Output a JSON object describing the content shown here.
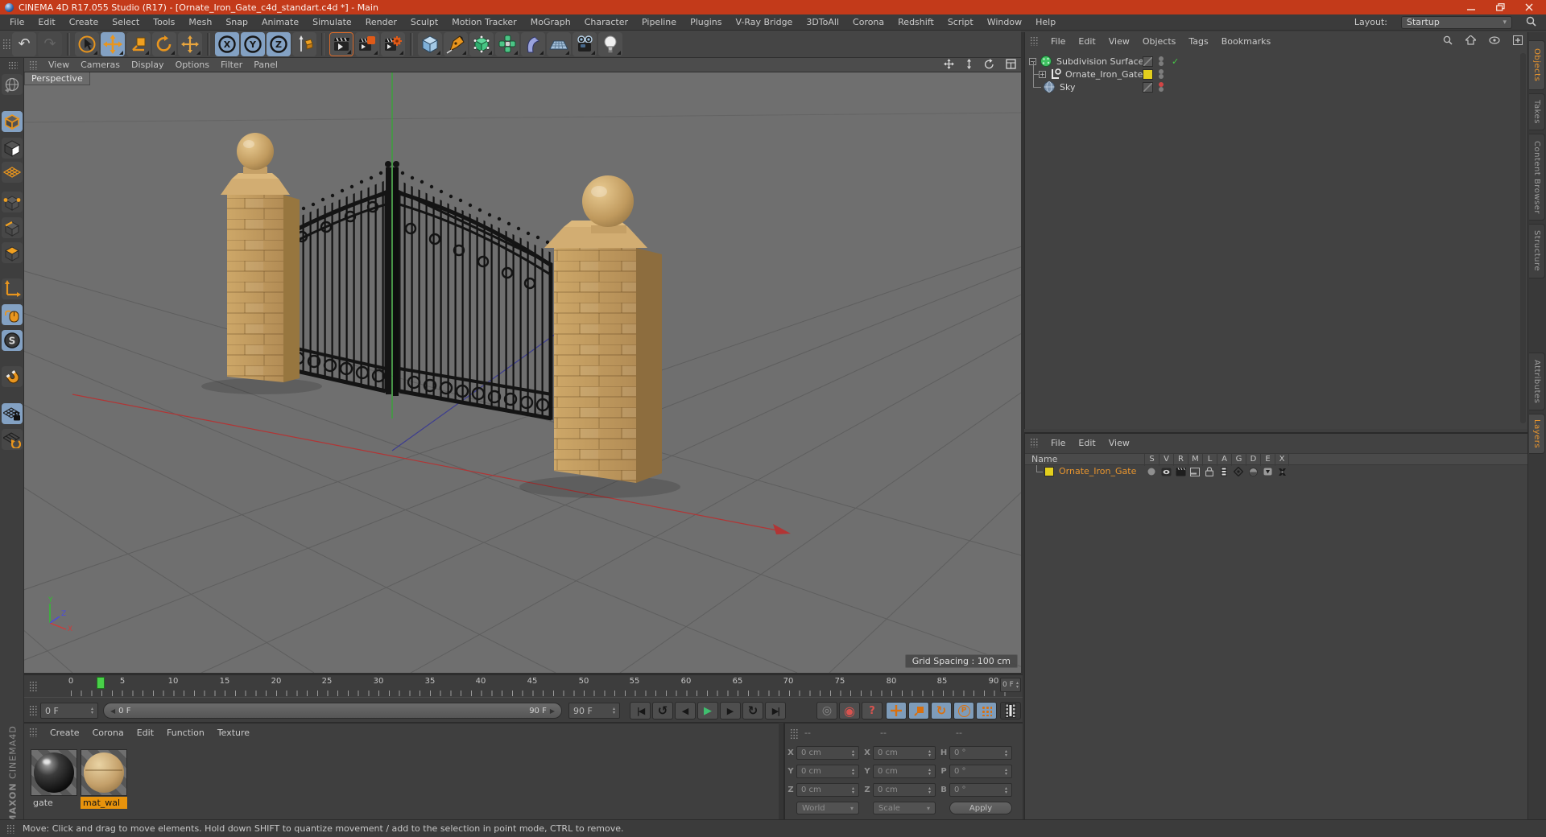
{
  "window": {
    "title": "CINEMA 4D R17.055 Studio (R17) - [Ornate_Iron_Gate_c4d_standart.c4d *] - Main"
  },
  "menubar": {
    "items": [
      "File",
      "Edit",
      "Create",
      "Select",
      "Tools",
      "Mesh",
      "Snap",
      "Animate",
      "Simulate",
      "Render",
      "Sculpt",
      "Motion Tracker",
      "MoGraph",
      "Character",
      "Pipeline",
      "Plugins",
      "V-Ray Bridge",
      "3DToAll",
      "Corona",
      "Redshift",
      "Script",
      "Window",
      "Help"
    ],
    "layout_label": "Layout:",
    "layout_value": "Startup"
  },
  "toolbar": {
    "axis_labels": [
      "X",
      "Y",
      "Z"
    ]
  },
  "left_toolbar": {
    "snap_label": "S"
  },
  "viewport": {
    "menu": [
      "View",
      "Cameras",
      "Display",
      "Options",
      "Filter",
      "Panel"
    ],
    "view_label": "Perspective",
    "grid_spacing_label": "Grid Spacing : 100 cm",
    "axis_x": "X",
    "axis_y": "Y",
    "axis_z": "Z"
  },
  "object_manager": {
    "menu": [
      "File",
      "Edit",
      "View",
      "Objects",
      "Tags",
      "Bookmarks"
    ],
    "objects": [
      {
        "name": "Subdivision Surface"
      },
      {
        "name": "Ornate_Iron_Gate"
      },
      {
        "name": "Sky"
      }
    ],
    "enabled_check": "✓"
  },
  "right_tabs": {
    "top": [
      "Objects",
      "Takes",
      "Content Browser",
      "Structure"
    ],
    "bottom": [
      "Attributes",
      "Layers"
    ]
  },
  "layer_manager": {
    "menu": [
      "File",
      "Edit",
      "View"
    ],
    "name_column": "Name",
    "columns": [
      "S",
      "V",
      "R",
      "M",
      "L",
      "A",
      "G",
      "D",
      "E",
      "X"
    ],
    "row_name": "Ornate_Iron_Gate"
  },
  "timeline": {
    "ticks": [
      "0",
      "5",
      "10",
      "15",
      "20",
      "25",
      "30",
      "35",
      "40",
      "45",
      "50",
      "55",
      "60",
      "65",
      "70",
      "75",
      "80",
      "85",
      "90"
    ],
    "frame_field": "0 F"
  },
  "transport": {
    "current_frame": "0 F",
    "range_start": "0 F",
    "range_end": "90 F",
    "end_frame": "90 F",
    "record_param": "P"
  },
  "materials": {
    "menu": [
      "Create",
      "Corona",
      "Edit",
      "Function",
      "Texture"
    ],
    "items": [
      {
        "name": "gate",
        "selected": false
      },
      {
        "name": "mat_wal",
        "selected": true
      }
    ]
  },
  "coordinates": {
    "headers": [
      "--",
      "--",
      "--"
    ],
    "col1": {
      "labels": [
        "X",
        "Y",
        "Z"
      ],
      "values": [
        "0 cm",
        "0 cm",
        "0 cm"
      ]
    },
    "col2": {
      "labels": [
        "X",
        "Y",
        "Z"
      ],
      "values": [
        "0 cm",
        "0 cm",
        "0 cm"
      ]
    },
    "col3": {
      "labels": [
        "H",
        "P",
        "B"
      ],
      "values": [
        "0 °",
        "0 °",
        "0 °"
      ]
    },
    "system": "World",
    "mode": "Scale",
    "apply": "Apply"
  },
  "statusbar": {
    "text": "Move: Click and drag to move elements. Hold down SHIFT to quantize movement / add to the selection in point mode, CTRL to remove."
  },
  "brand": {
    "maxon": "MAXON",
    "product": "CINEMA4D"
  },
  "icons": {
    "goto_start": "|◀",
    "play_backwards": "↺",
    "prev_frame": "◀",
    "play": "▶",
    "next_frame": "▶",
    "loop": "↻",
    "goto_end": "▶|",
    "record_key": "◎",
    "autokey": "◉",
    "autokey_help": "?",
    "record_rotation": "↻",
    "undo": "↶",
    "redo": "↷",
    "dropdown_arrow": "▾",
    "stepper_up": "▴",
    "stepper_down": "▾",
    "slider_left": "◀",
    "slider_right": "▶",
    "home": "⌂",
    "plus": "+",
    "minus": "−",
    "expand_minus": "−",
    "expand_plus": "+"
  },
  "colors": {
    "accent_orange": "#e8951e",
    "highlight_blue": "#83a1c3",
    "titlebar_red": "#c33a1a",
    "selected_text": "#e8952e",
    "layer_yellow": "#e3cf1d"
  }
}
